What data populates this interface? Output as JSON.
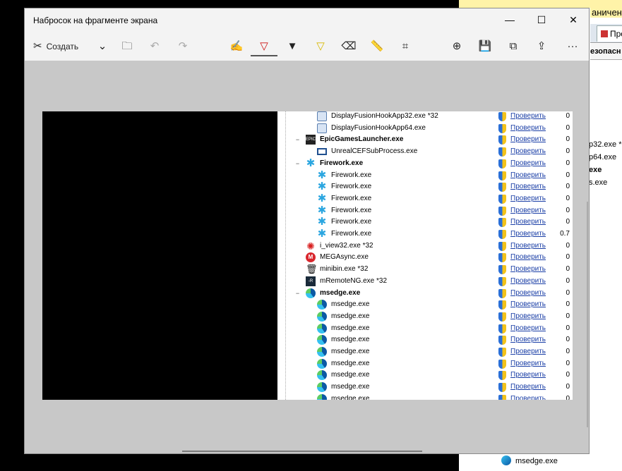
{
  "background_app": {
    "banner_text": "аниченн",
    "tab_label": "Про",
    "column_header": "езопасн",
    "partial_rows": [
      "p32.exe *",
      "p64.exe",
      "exe",
      "s.exe"
    ],
    "bottom_row": "msedge.exe"
  },
  "window": {
    "title": "Набросок на фрагменте экрана",
    "controls": {
      "minimize": "—",
      "maximize": "☐",
      "close": "✕"
    }
  },
  "toolbar": {
    "create_label": "Создать",
    "create_icon": "scissors-icon",
    "dropdown_icon": "⌄",
    "open_icon": "🗀",
    "undo_icon": "↶",
    "redo_icon": "↷",
    "touch_icon": "✍",
    "pen_icon": "▽",
    "pencil_icon": "▼",
    "highlighter_icon": "▽",
    "eraser_icon": "⌫",
    "ruler_icon": "📏",
    "crop_icon": "⌗",
    "zoom_icon": "⊕",
    "save_icon": "💾",
    "copy_icon": "⧉",
    "share_icon": "⇪",
    "more_icon": "···"
  },
  "process_list": {
    "verify_label": "Проверить",
    "rows": [
      {
        "name": "DisplayFusionHookApp32.exe *32",
        "level": 2,
        "icon": "dfh",
        "bold": false,
        "cpu": "0",
        "expander": ""
      },
      {
        "name": "DisplayFusionHookApp64.exe",
        "level": 2,
        "icon": "dfh",
        "bold": false,
        "cpu": "0",
        "expander": ""
      },
      {
        "name": "EpicGamesLauncher.exe",
        "level": 1,
        "icon": "epic",
        "bold": true,
        "cpu": "0",
        "expander": "−"
      },
      {
        "name": "UnrealCEFSubProcess.exe",
        "level": 2,
        "icon": "unreal",
        "bold": false,
        "cpu": "0",
        "expander": ""
      },
      {
        "name": "Firework.exe",
        "level": 1,
        "icon": "fw",
        "bold": true,
        "cpu": "0",
        "expander": "−"
      },
      {
        "name": "Firework.exe",
        "level": 2,
        "icon": "fw",
        "bold": false,
        "cpu": "0",
        "expander": ""
      },
      {
        "name": "Firework.exe",
        "level": 2,
        "icon": "fw",
        "bold": false,
        "cpu": "0",
        "expander": ""
      },
      {
        "name": "Firework.exe",
        "level": 2,
        "icon": "fw",
        "bold": false,
        "cpu": "0",
        "expander": ""
      },
      {
        "name": "Firework.exe",
        "level": 2,
        "icon": "fw",
        "bold": false,
        "cpu": "0",
        "expander": ""
      },
      {
        "name": "Firework.exe",
        "level": 2,
        "icon": "fw",
        "bold": false,
        "cpu": "0",
        "expander": ""
      },
      {
        "name": "Firework.exe",
        "level": 2,
        "icon": "fw",
        "bold": false,
        "cpu": "0.7",
        "expander": ""
      },
      {
        "name": "i_view32.exe *32",
        "level": 1,
        "icon": "iv",
        "bold": false,
        "cpu": "0",
        "expander": ""
      },
      {
        "name": "MEGAsync.exe",
        "level": 1,
        "icon": "mega",
        "bold": false,
        "cpu": "0",
        "expander": ""
      },
      {
        "name": "minibin.exe *32",
        "level": 1,
        "icon": "bin",
        "bold": false,
        "cpu": "0",
        "expander": ""
      },
      {
        "name": "mRemoteNG.exe *32",
        "level": 1,
        "icon": "mr",
        "bold": false,
        "cpu": "0",
        "expander": ""
      },
      {
        "name": "msedge.exe",
        "level": 1,
        "icon": "edge",
        "bold": true,
        "cpu": "0",
        "expander": "−"
      },
      {
        "name": "msedge.exe",
        "level": 2,
        "icon": "edge",
        "bold": false,
        "cpu": "0",
        "expander": ""
      },
      {
        "name": "msedge.exe",
        "level": 2,
        "icon": "edge",
        "bold": false,
        "cpu": "0",
        "expander": ""
      },
      {
        "name": "msedge.exe",
        "level": 2,
        "icon": "edge",
        "bold": false,
        "cpu": "0",
        "expander": ""
      },
      {
        "name": "msedge.exe",
        "level": 2,
        "icon": "edge",
        "bold": false,
        "cpu": "0",
        "expander": ""
      },
      {
        "name": "msedge.exe",
        "level": 2,
        "icon": "edge",
        "bold": false,
        "cpu": "0",
        "expander": ""
      },
      {
        "name": "msedge.exe",
        "level": 2,
        "icon": "edge",
        "bold": false,
        "cpu": "0",
        "expander": ""
      },
      {
        "name": "msedge.exe",
        "level": 2,
        "icon": "edge",
        "bold": false,
        "cpu": "0",
        "expander": ""
      },
      {
        "name": "msedge.exe",
        "level": 2,
        "icon": "edge",
        "bold": false,
        "cpu": "0",
        "expander": ""
      },
      {
        "name": "msedge.exe",
        "level": 2,
        "icon": "edge",
        "bold": false,
        "cpu": "0",
        "expander": ""
      }
    ]
  }
}
